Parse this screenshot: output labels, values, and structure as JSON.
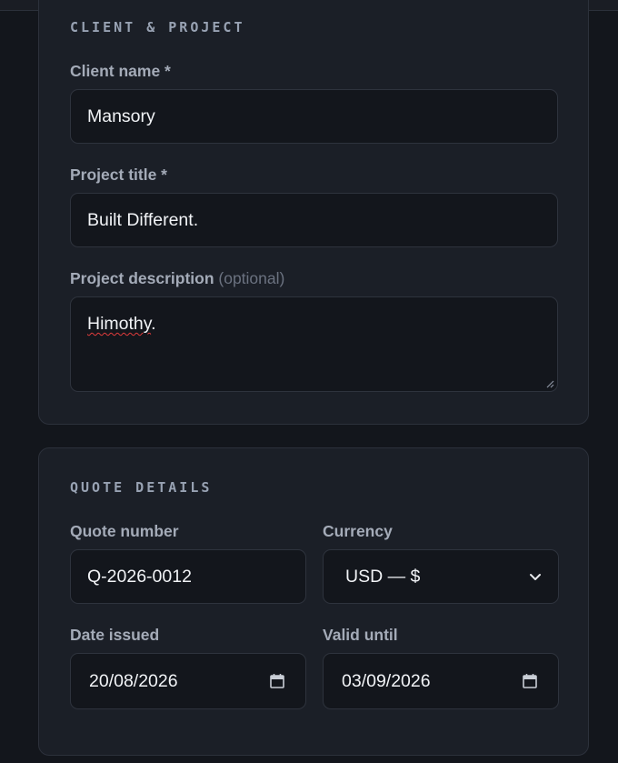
{
  "client_section": {
    "title": "CLIENT & PROJECT",
    "client_name_label": "Client name *",
    "client_name_value": "Mansory",
    "project_title_label": "Project title *",
    "project_title_value": "Built Different.",
    "project_description_label": "Project description",
    "project_description_optional": "(optional)",
    "project_description_value": "Himothy",
    "project_description_suffix": "."
  },
  "quote_section": {
    "title": "QUOTE DETAILS",
    "quote_number_label": "Quote number",
    "quote_number_value": "Q-2026-0012",
    "currency_label": "Currency",
    "currency_value": "USD — $",
    "date_issued_label": "Date issued",
    "date_issued_value": "20/08/2026",
    "valid_until_label": "Valid until",
    "valid_until_value": "03/09/2026"
  },
  "icons": {
    "currency_dropdown": "chevron-down-icon",
    "date_picker": "calendar-icon",
    "textarea_resize": "resize-grip-icon"
  }
}
